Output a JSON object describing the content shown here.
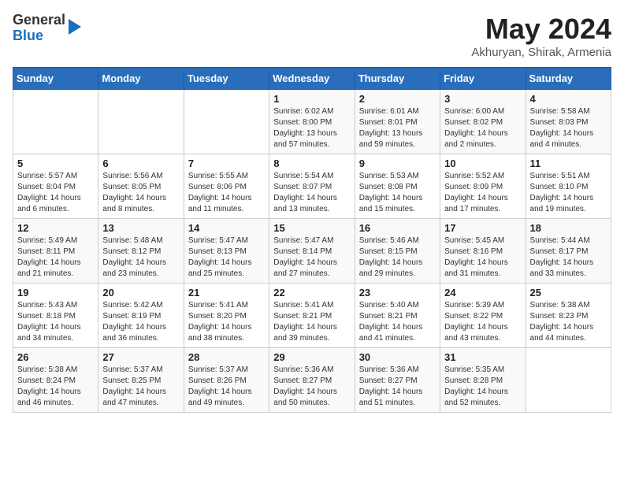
{
  "header": {
    "logo_general": "General",
    "logo_blue": "Blue",
    "month": "May 2024",
    "location": "Akhuryan, Shirak, Armenia"
  },
  "weekdays": [
    "Sunday",
    "Monday",
    "Tuesday",
    "Wednesday",
    "Thursday",
    "Friday",
    "Saturday"
  ],
  "weeks": [
    [
      {
        "day": "",
        "info": ""
      },
      {
        "day": "",
        "info": ""
      },
      {
        "day": "",
        "info": ""
      },
      {
        "day": "1",
        "info": "Sunrise: 6:02 AM\nSunset: 8:00 PM\nDaylight: 13 hours\nand 57 minutes."
      },
      {
        "day": "2",
        "info": "Sunrise: 6:01 AM\nSunset: 8:01 PM\nDaylight: 13 hours\nand 59 minutes."
      },
      {
        "day": "3",
        "info": "Sunrise: 6:00 AM\nSunset: 8:02 PM\nDaylight: 14 hours\nand 2 minutes."
      },
      {
        "day": "4",
        "info": "Sunrise: 5:58 AM\nSunset: 8:03 PM\nDaylight: 14 hours\nand 4 minutes."
      }
    ],
    [
      {
        "day": "5",
        "info": "Sunrise: 5:57 AM\nSunset: 8:04 PM\nDaylight: 14 hours\nand 6 minutes."
      },
      {
        "day": "6",
        "info": "Sunrise: 5:56 AM\nSunset: 8:05 PM\nDaylight: 14 hours\nand 8 minutes."
      },
      {
        "day": "7",
        "info": "Sunrise: 5:55 AM\nSunset: 8:06 PM\nDaylight: 14 hours\nand 11 minutes."
      },
      {
        "day": "8",
        "info": "Sunrise: 5:54 AM\nSunset: 8:07 PM\nDaylight: 14 hours\nand 13 minutes."
      },
      {
        "day": "9",
        "info": "Sunrise: 5:53 AM\nSunset: 8:08 PM\nDaylight: 14 hours\nand 15 minutes."
      },
      {
        "day": "10",
        "info": "Sunrise: 5:52 AM\nSunset: 8:09 PM\nDaylight: 14 hours\nand 17 minutes."
      },
      {
        "day": "11",
        "info": "Sunrise: 5:51 AM\nSunset: 8:10 PM\nDaylight: 14 hours\nand 19 minutes."
      }
    ],
    [
      {
        "day": "12",
        "info": "Sunrise: 5:49 AM\nSunset: 8:11 PM\nDaylight: 14 hours\nand 21 minutes."
      },
      {
        "day": "13",
        "info": "Sunrise: 5:48 AM\nSunset: 8:12 PM\nDaylight: 14 hours\nand 23 minutes."
      },
      {
        "day": "14",
        "info": "Sunrise: 5:47 AM\nSunset: 8:13 PM\nDaylight: 14 hours\nand 25 minutes."
      },
      {
        "day": "15",
        "info": "Sunrise: 5:47 AM\nSunset: 8:14 PM\nDaylight: 14 hours\nand 27 minutes."
      },
      {
        "day": "16",
        "info": "Sunrise: 5:46 AM\nSunset: 8:15 PM\nDaylight: 14 hours\nand 29 minutes."
      },
      {
        "day": "17",
        "info": "Sunrise: 5:45 AM\nSunset: 8:16 PM\nDaylight: 14 hours\nand 31 minutes."
      },
      {
        "day": "18",
        "info": "Sunrise: 5:44 AM\nSunset: 8:17 PM\nDaylight: 14 hours\nand 33 minutes."
      }
    ],
    [
      {
        "day": "19",
        "info": "Sunrise: 5:43 AM\nSunset: 8:18 PM\nDaylight: 14 hours\nand 34 minutes."
      },
      {
        "day": "20",
        "info": "Sunrise: 5:42 AM\nSunset: 8:19 PM\nDaylight: 14 hours\nand 36 minutes."
      },
      {
        "day": "21",
        "info": "Sunrise: 5:41 AM\nSunset: 8:20 PM\nDaylight: 14 hours\nand 38 minutes."
      },
      {
        "day": "22",
        "info": "Sunrise: 5:41 AM\nSunset: 8:21 PM\nDaylight: 14 hours\nand 39 minutes."
      },
      {
        "day": "23",
        "info": "Sunrise: 5:40 AM\nSunset: 8:21 PM\nDaylight: 14 hours\nand 41 minutes."
      },
      {
        "day": "24",
        "info": "Sunrise: 5:39 AM\nSunset: 8:22 PM\nDaylight: 14 hours\nand 43 minutes."
      },
      {
        "day": "25",
        "info": "Sunrise: 5:38 AM\nSunset: 8:23 PM\nDaylight: 14 hours\nand 44 minutes."
      }
    ],
    [
      {
        "day": "26",
        "info": "Sunrise: 5:38 AM\nSunset: 8:24 PM\nDaylight: 14 hours\nand 46 minutes."
      },
      {
        "day": "27",
        "info": "Sunrise: 5:37 AM\nSunset: 8:25 PM\nDaylight: 14 hours\nand 47 minutes."
      },
      {
        "day": "28",
        "info": "Sunrise: 5:37 AM\nSunset: 8:26 PM\nDaylight: 14 hours\nand 49 minutes."
      },
      {
        "day": "29",
        "info": "Sunrise: 5:36 AM\nSunset: 8:27 PM\nDaylight: 14 hours\nand 50 minutes."
      },
      {
        "day": "30",
        "info": "Sunrise: 5:36 AM\nSunset: 8:27 PM\nDaylight: 14 hours\nand 51 minutes."
      },
      {
        "day": "31",
        "info": "Sunrise: 5:35 AM\nSunset: 8:28 PM\nDaylight: 14 hours\nand 52 minutes."
      },
      {
        "day": "",
        "info": ""
      }
    ]
  ]
}
